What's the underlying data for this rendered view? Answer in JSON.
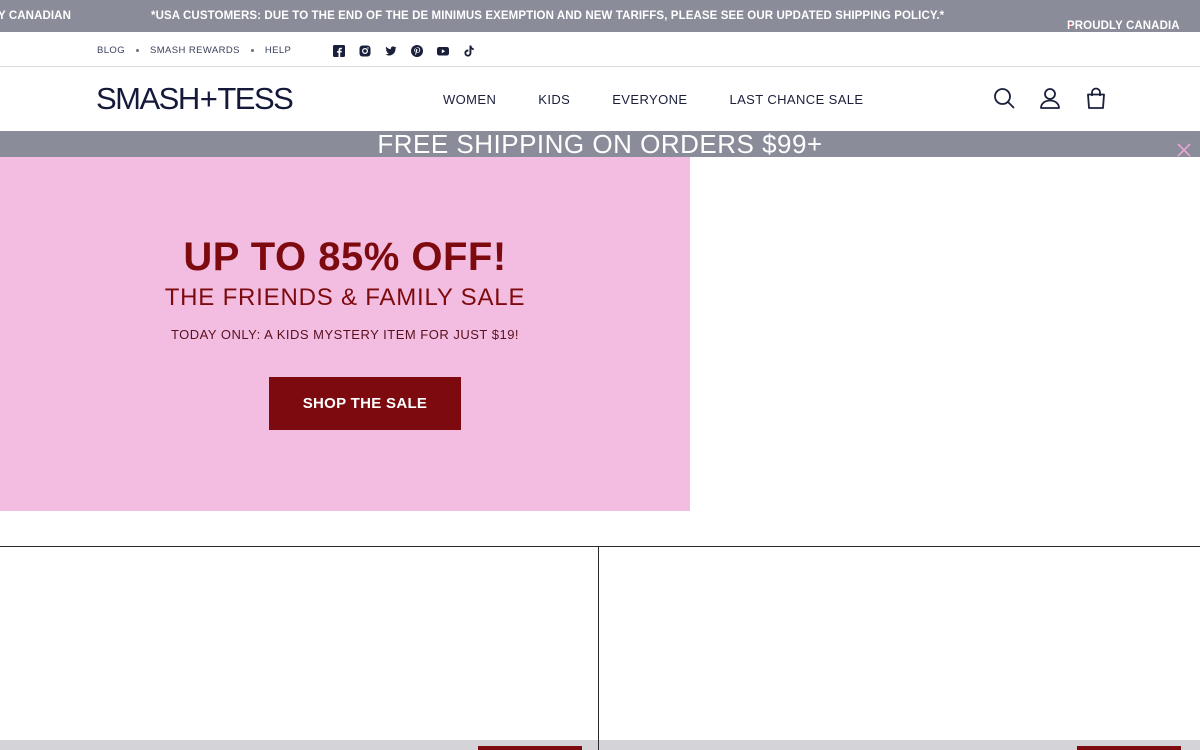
{
  "ticker": {
    "msg1": "Y CANADIAN",
    "msg2": "*USA CUSTOMERS: DUE TO THE END OF THE DE MINIMUS EXEMPTION AND NEW TARIFFS, PLEASE SEE OUR UPDATED SHIPPING POLICY.*",
    "msg3": "PROUDLY CANADIA",
    "leaf_icon": "maple-leaf-icon"
  },
  "utility": {
    "links": [
      "BLOG",
      "SMASH REWARDS",
      "HELP"
    ],
    "social_icons": [
      "facebook-icon",
      "instagram-icon",
      "twitter-icon",
      "pinterest-icon",
      "youtube-icon",
      "tiktok-icon"
    ]
  },
  "header": {
    "logo_left": "SMASH",
    "logo_plus": "+",
    "logo_right": "TESS",
    "nav": [
      "WOMEN",
      "KIDS",
      "EVERYONE",
      "LAST CHANCE SALE"
    ],
    "icons": [
      "search-icon",
      "account-icon",
      "cart-icon"
    ]
  },
  "shipping": {
    "text": "FREE SHIPPING ON ORDERS $99+"
  },
  "hero": {
    "headline": "UP TO 85% OFF!",
    "subhead": "THE FRIENDS & FAMILY SALE",
    "note": "TODAY ONLY: A KIDS MYSTERY ITEM FOR JUST $19!",
    "cta": "SHOP THE SALE"
  },
  "colors": {
    "bar_grey": "#8a8c99",
    "hero_pink": "#f2bde0",
    "accent_maroon": "#7d0a0e",
    "navy": "#14193a"
  }
}
